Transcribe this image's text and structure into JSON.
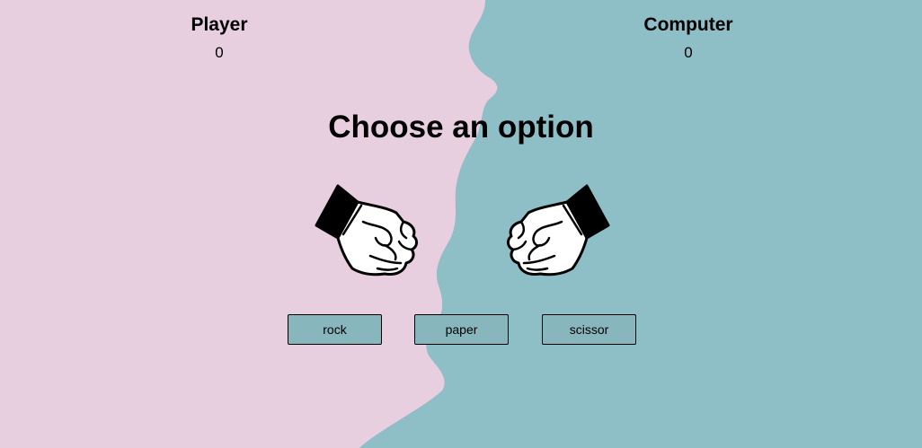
{
  "scoreboard": {
    "player_label": "Player",
    "player_score": "0",
    "computer_label": "Computer",
    "computer_score": "0"
  },
  "heading": "Choose an option",
  "hands": {
    "player_icon": "fist-icon",
    "computer_icon": "fist-icon"
  },
  "buttons": {
    "rock": "rock",
    "paper": "paper",
    "scissor": "scissor"
  },
  "colors": {
    "pink_background": "#e8cfe0",
    "teal_background": "#8ebec6",
    "button_fill": "#88b6bd"
  }
}
